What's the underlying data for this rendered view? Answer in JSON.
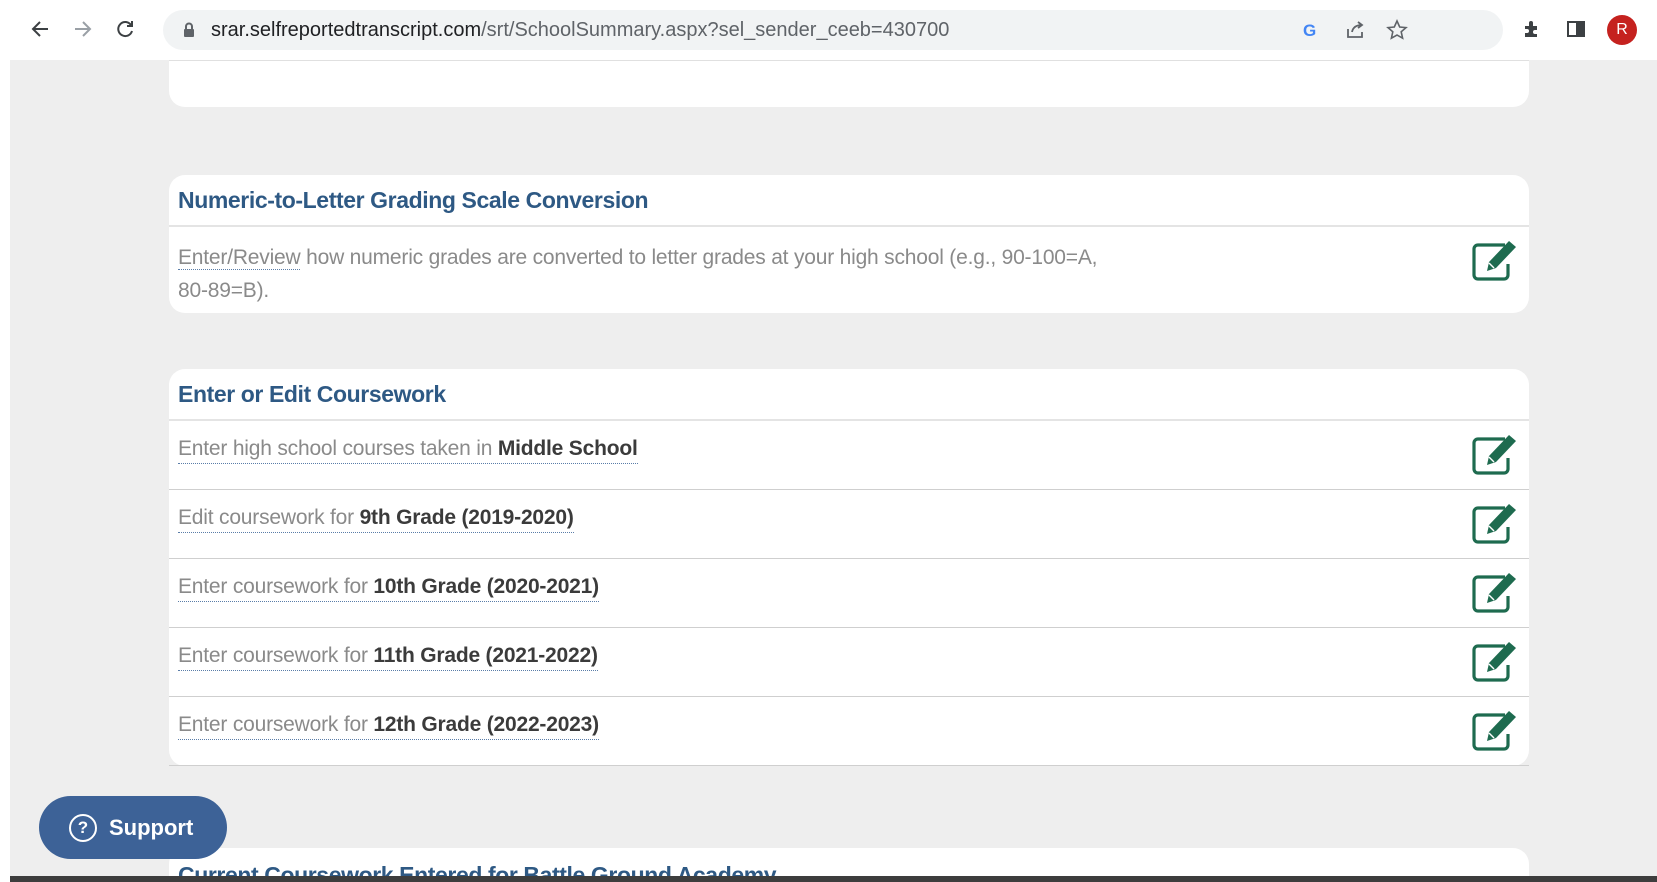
{
  "browser": {
    "url_host": "srar.selfreportedtranscript.com",
    "url_path": "/srt/SchoolSummary.aspx?sel_sender_ceeb=430700",
    "profile_initial": "R"
  },
  "grading": {
    "title": "Numeric-to-Letter Grading Scale Conversion",
    "link_text": "Enter/Review",
    "description_line1": " how numeric grades are converted to letter grades at your high school (e.g., 90-100=A,",
    "description_line2": "80-89=B)."
  },
  "coursework": {
    "title": "Enter or Edit Coursework",
    "rows": [
      {
        "prefix": "Enter high school courses taken in ",
        "bold": "Middle School"
      },
      {
        "prefix": "Edit coursework for ",
        "bold": "9th Grade (2019-2020)"
      },
      {
        "prefix": "Enter coursework for ",
        "bold": "10th Grade (2020-2021)"
      },
      {
        "prefix": "Enter coursework for ",
        "bold": "11th Grade (2021-2022)"
      },
      {
        "prefix": "Enter coursework for ",
        "bold": "12th Grade (2022-2023)"
      }
    ]
  },
  "current": {
    "title": "Current Coursework Entered for Battle Ground Academy"
  },
  "support": {
    "label": "Support",
    "icon_glyph": "?"
  },
  "colors": {
    "heading": "#2e5984",
    "edit_icon": "#1e6b4f",
    "support_bg": "#3d6297"
  }
}
